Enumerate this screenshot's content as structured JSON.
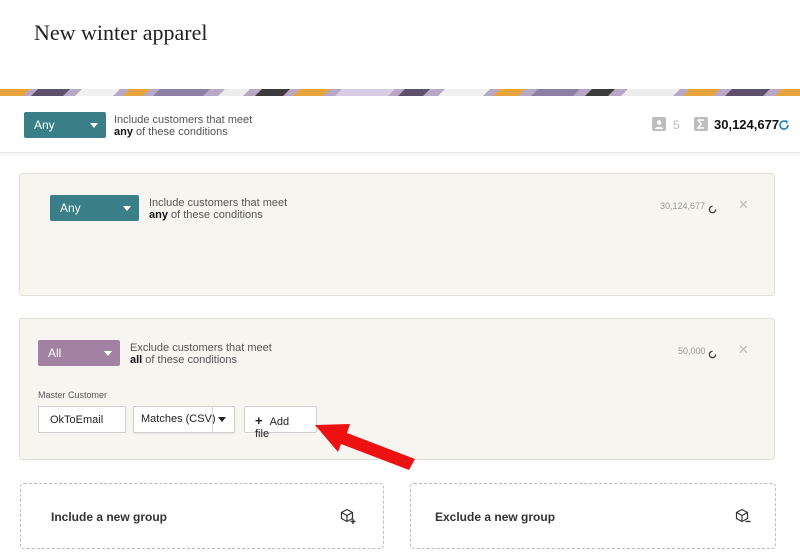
{
  "page": {
    "title": "New winter apparel"
  },
  "colors": {
    "teal": "#3a7f87",
    "purple": "#a281a3",
    "refresh": "#1e7fbd",
    "arrow": "#ee1111"
  },
  "header": {
    "match_select": "Any",
    "cond_line1": "Include customers that meet",
    "cond_bold": "any",
    "cond_rest": " of these conditions",
    "segments_count": "5",
    "total": "30,124,677"
  },
  "include_group": {
    "match_select": "Any",
    "cond_line1": "Include customers that meet",
    "cond_bold": "any",
    "cond_rest": " of these conditions",
    "count": "30,124,677"
  },
  "exclude_group": {
    "match_select": "All",
    "cond_line1": "Exclude customers that meet",
    "cond_bold": "all",
    "cond_rest": " of these conditions",
    "count": "50,000",
    "condition": {
      "field_label": "Master Customer",
      "attribute": "OkToEmail",
      "operator": "Matches (CSV)",
      "add_file": "Add file"
    }
  },
  "actions": {
    "include_new": "Include a new group",
    "exclude_new": "Exclude a new group"
  },
  "icons": [
    "segment-icon",
    "sigma-icon",
    "refresh-icon",
    "spinner-icon",
    "close-icon",
    "chevron-down-icon",
    "plus-icon",
    "add-group-icon",
    "remove-group-icon",
    "arrow-annotation"
  ]
}
